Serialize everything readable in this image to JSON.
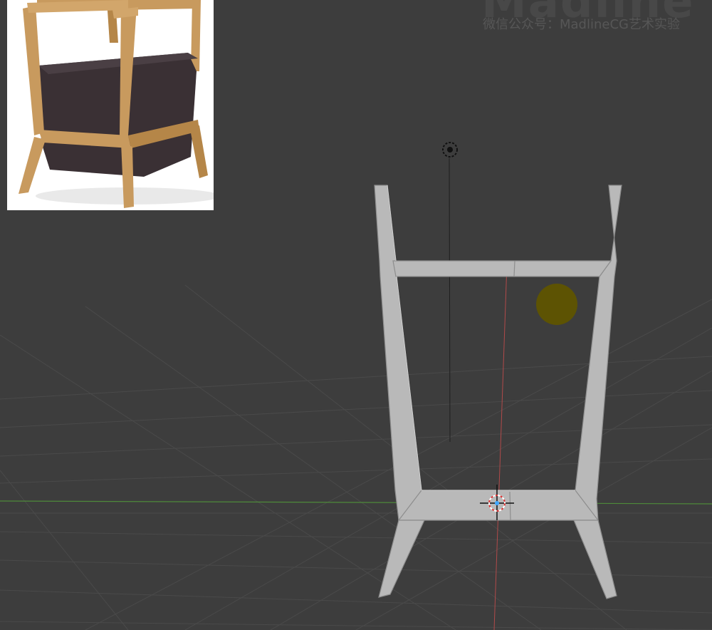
{
  "watermark": {
    "title": "Madline",
    "subtitle": "微信公众号：MadlineCG艺术实验"
  },
  "reference_image": {
    "subject": "wooden-chair-photo",
    "colors": {
      "wood": "#c89a5e",
      "cushion": "#3a3034",
      "background": "#ffffff"
    }
  },
  "viewport": {
    "colors": {
      "background": "#3d3d3d",
      "grid": "#4a4a4a",
      "x_axis": "#4e8a3a",
      "y_axis": "#b14a4a",
      "mesh": "#b9b9b9",
      "mesh_edge": "#8d8d8d",
      "light": "#5f5400"
    },
    "icons": [
      "camera-icon",
      "light-icon",
      "3d-cursor-icon",
      "origin-icon"
    ]
  }
}
